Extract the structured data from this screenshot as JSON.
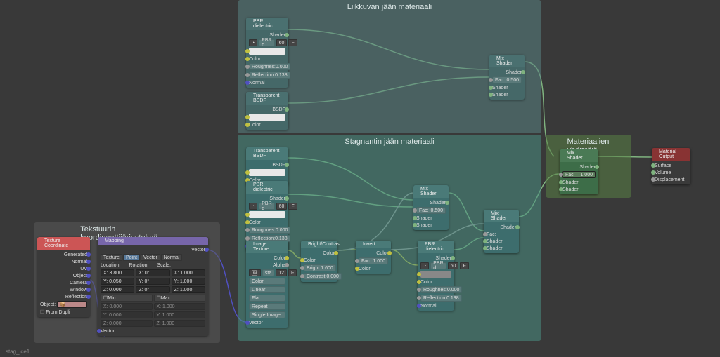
{
  "hint": "stag_ice1",
  "frames": {
    "tex": {
      "label": "Tekstuurin koordinaattijäriestelmä"
    },
    "moving": {
      "label": "Liikkuvan jään materiaali"
    },
    "stagnant": {
      "label": "Stagnantin jään materiaali"
    },
    "combine": {
      "label": "Materiaalien yhdistäjä"
    }
  },
  "labels": {
    "shader": "Shader",
    "bsdf": "BSDF",
    "color": "Color",
    "normal": "Normal",
    "roughness": "Roughnes:",
    "reflection": "Reflection:",
    "fac": "Fac:",
    "vector": "Vector",
    "alpha": "Alpha",
    "surface": "Surface",
    "volume": "Volume",
    "displacement": "Displacement",
    "bright": "Bright:",
    "contrast": "Contrast:",
    "location": "Location:",
    "rotation": "Rotation:",
    "scale": "Scale:",
    "min": "Min",
    "max": "Max",
    "generated": "Generated",
    "normal_out": "Normal",
    "uv": "UV",
    "object_out": "Object",
    "camera": "Camera",
    "window": "Window",
    "reflection_out": "Reflection",
    "object_lbl": "Object:",
    "from_dupli": "From Dupli",
    "linear": "Linear",
    "flat": "Flat",
    "repeat": "Repeat",
    "single_image": "Single Image"
  },
  "nodes": {
    "texcoord": {
      "title": "Texture Coordinate"
    },
    "mapping": {
      "title": "Mapping",
      "tabs": [
        "Texture",
        "Point",
        "Vector",
        "Normal"
      ],
      "loc": {
        "x": "X: 3.800",
        "y": "Y: 0.050",
        "z": "Z: 0.000"
      },
      "rot": {
        "x": "X: 0°",
        "y": "Y: 0°",
        "z": "Z: 0°"
      },
      "scl": {
        "x": "X: 1.000",
        "y": "Y: 1.000",
        "z": "Z: 1.000"
      },
      "min": {
        "x": "X: 0.000",
        "y": "Y: 0.000",
        "z": "Z: 0.000"
      },
      "max": {
        "x": "X: 1.000",
        "y": "Y: 1.000",
        "z": "Z: 1.000"
      }
    },
    "pbr1": {
      "title": "PBR dielectric",
      "group": "PBR d",
      "strength": "60",
      "f": "F",
      "rough": "0.000",
      "refl": "0.138"
    },
    "transp1": {
      "title": "Transparent BSDF"
    },
    "mix1": {
      "title": "Mix Shader",
      "fac": "0.500"
    },
    "transp2": {
      "title": "Transparent BSDF"
    },
    "pbr2": {
      "title": "PBR dielectric",
      "group": "PBR d",
      "strength": "60",
      "f": "F",
      "rough": "0.000",
      "refl": "0.138"
    },
    "imgtex": {
      "title": "Image Texture",
      "fields": [
        "sta",
        "12",
        "F"
      ]
    },
    "brightcontrast": {
      "title": "Bright/Contrast",
      "bright": "1.600",
      "contrast": "0.000"
    },
    "invert": {
      "title": "Invert",
      "fac": "1.000"
    },
    "mix2": {
      "title": "Mix Shader",
      "fac": "0.500"
    },
    "pbr3": {
      "title": "PBR dielectric",
      "group": "PBR d",
      "strength": "60",
      "f": "F",
      "rough": "0.000",
      "refl": "0.138"
    },
    "mix3": {
      "title": "Mix Shader"
    },
    "mix4": {
      "title": "Mix Shader",
      "fac": "1.000"
    },
    "output": {
      "title": "Material Output"
    }
  }
}
